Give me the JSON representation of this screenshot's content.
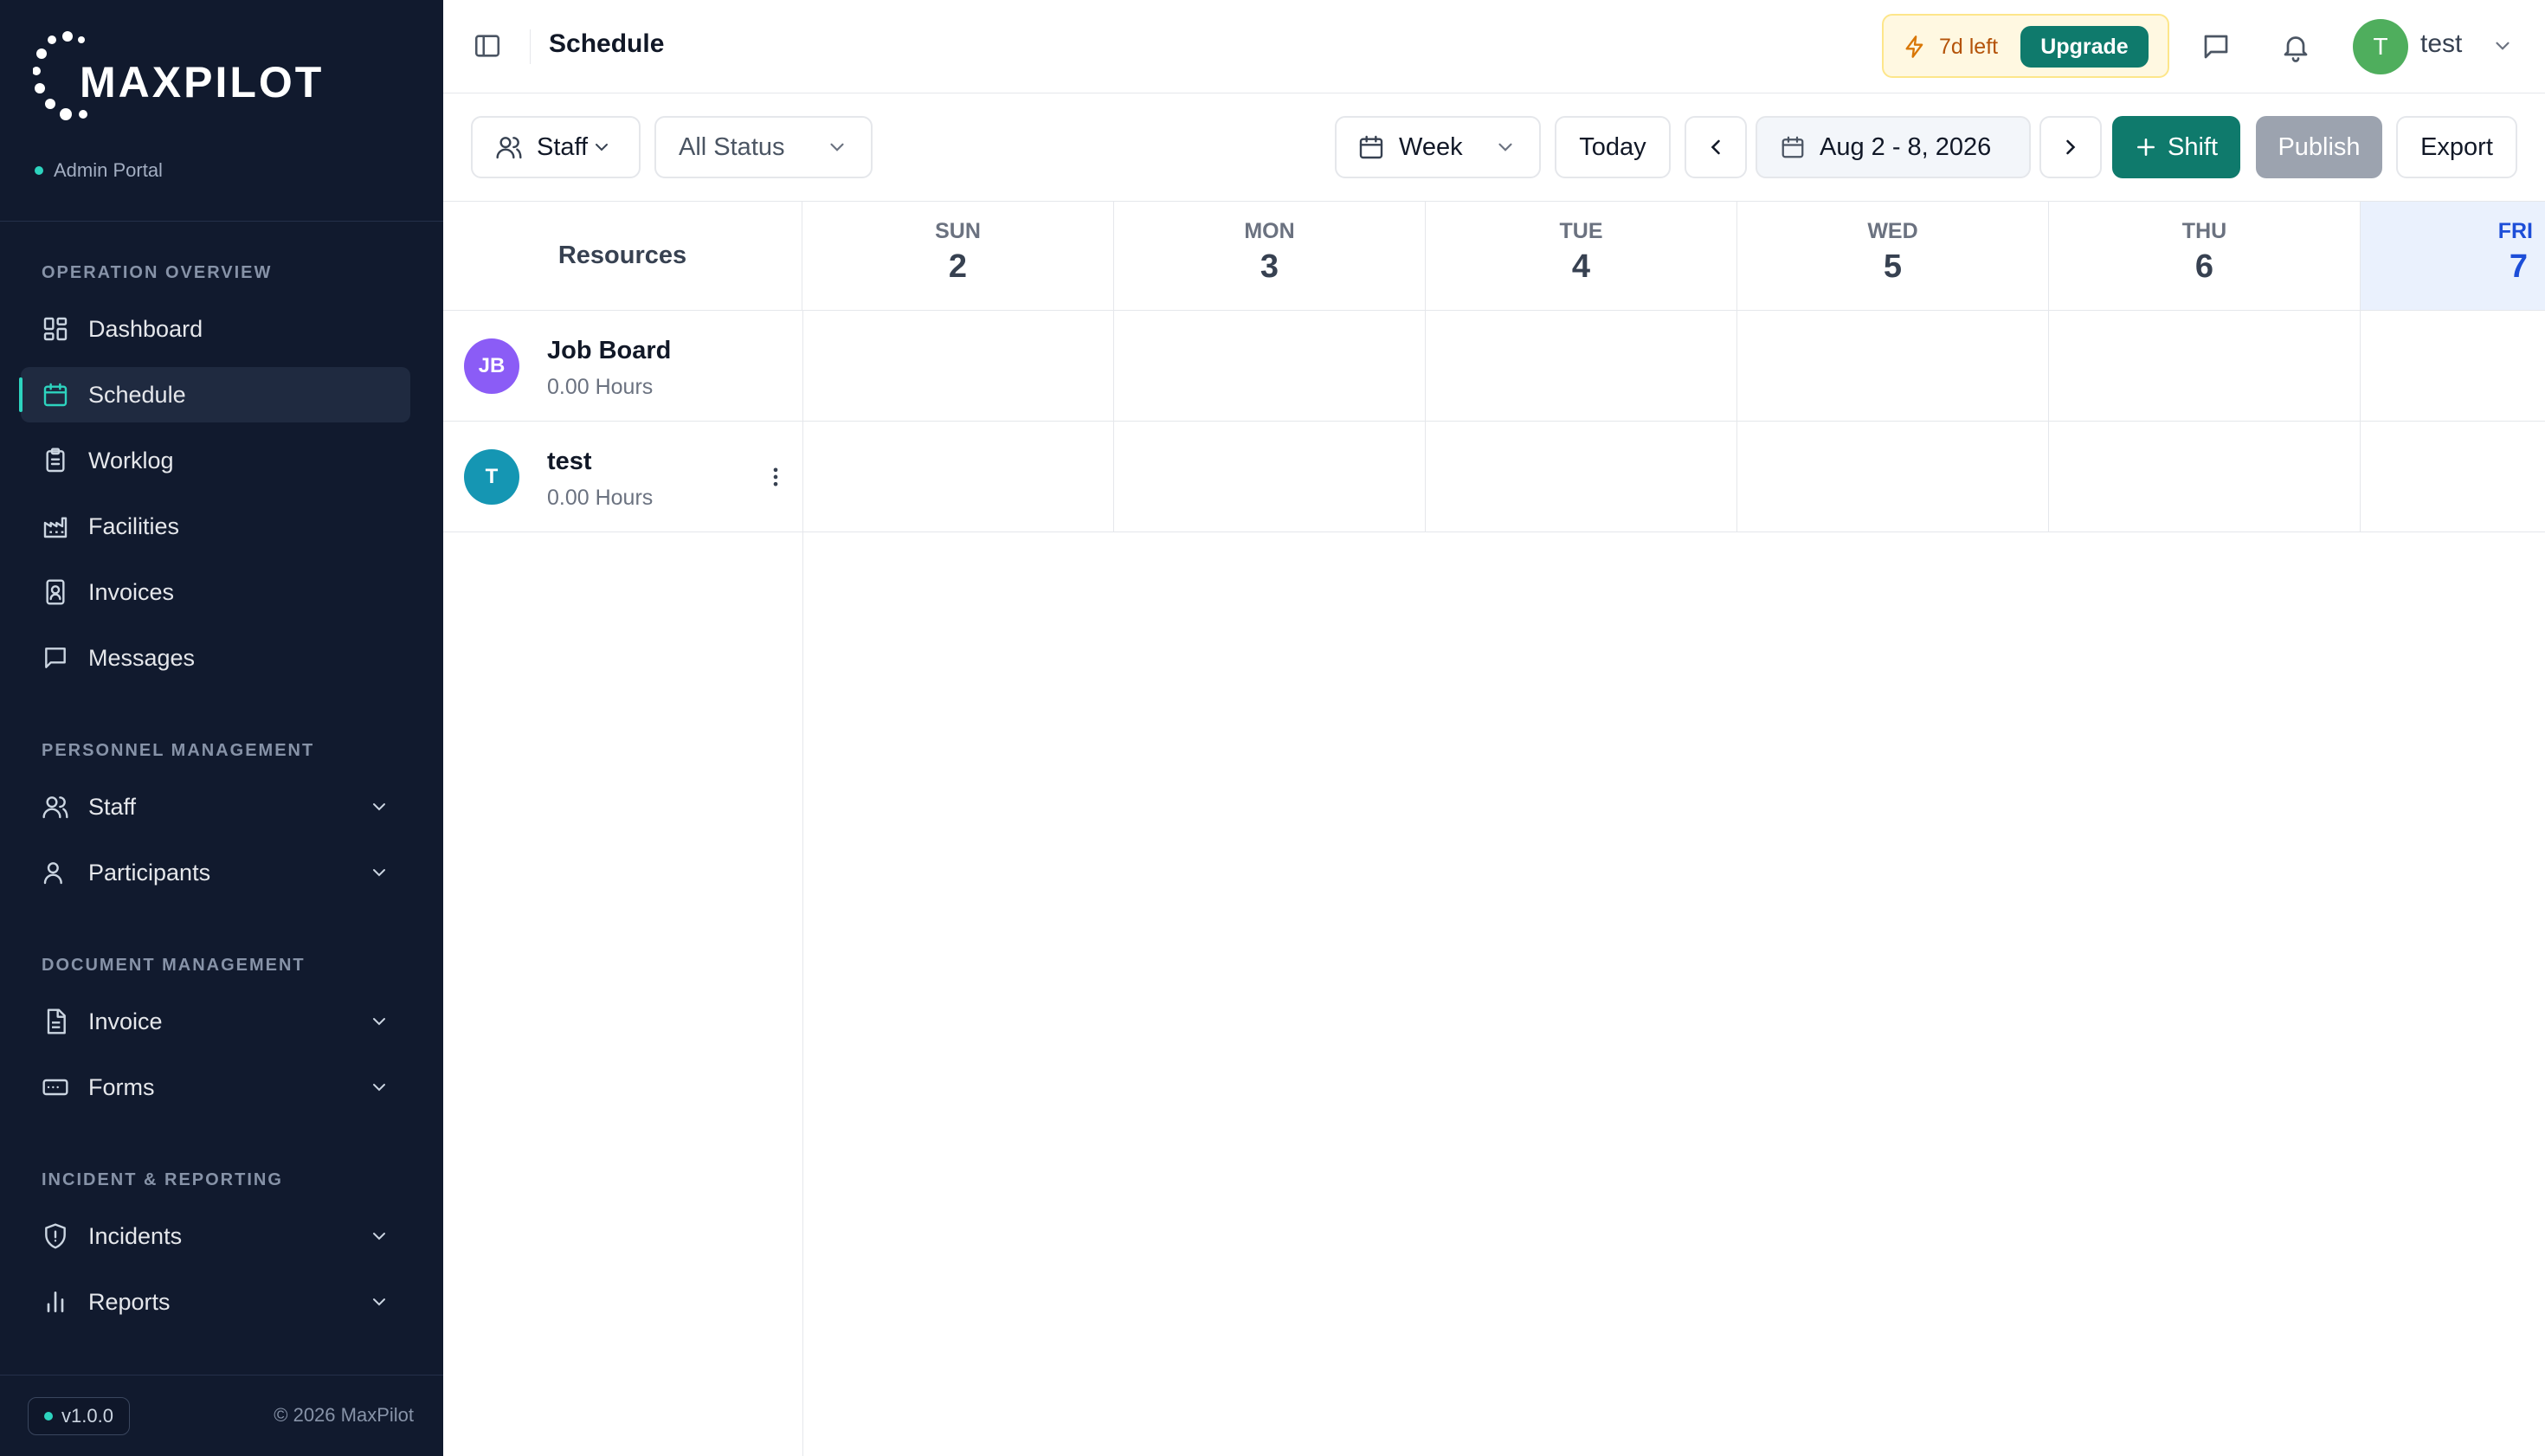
{
  "sidebar": {
    "brand": "MAXPILOT",
    "portal": "Admin Portal",
    "sections": {
      "operation": "OPERATION OVERVIEW",
      "personnel": "PERSONNEL MANAGEMENT",
      "document": "DOCUMENT MANAGEMENT",
      "incident": "INCIDENT & REPORTING"
    },
    "items": [
      {
        "label": "Dashboard"
      },
      {
        "label": "Schedule"
      },
      {
        "label": "Worklog"
      },
      {
        "label": "Facilities"
      },
      {
        "label": "Invoices"
      },
      {
        "label": "Messages"
      },
      {
        "label": "Staff"
      },
      {
        "label": "Participants"
      },
      {
        "label": "Invoice"
      },
      {
        "label": "Forms"
      },
      {
        "label": "Incidents"
      },
      {
        "label": "Reports"
      }
    ],
    "version": "v1.0.0",
    "copyright": "© 2026 MaxPilot"
  },
  "header": {
    "title": "Schedule",
    "trial_text": "7d left",
    "upgrade_label": "Upgrade",
    "user_initial": "T",
    "user_name": "test"
  },
  "toolbar": {
    "resource_filter": "Staff",
    "status_filter": "All Status",
    "view_mode": "Week",
    "today_label": "Today",
    "date_range": "Aug 2 - 8, 2026",
    "add_shift_label": "Shift",
    "publish_label": "Publish",
    "export_label": "Export"
  },
  "calendar": {
    "resources_header": "Resources",
    "days": [
      {
        "name": "SUN",
        "num": "2"
      },
      {
        "name": "MON",
        "num": "3"
      },
      {
        "name": "TUE",
        "num": "4"
      },
      {
        "name": "WED",
        "num": "5"
      },
      {
        "name": "THU",
        "num": "6"
      },
      {
        "name": "FRI",
        "num": "7"
      }
    ],
    "resources": [
      {
        "initials": "JB",
        "name": "Job Board",
        "hours": "0.00 Hours"
      },
      {
        "initials": "T",
        "name": "test",
        "hours": "0.00 Hours"
      }
    ]
  },
  "colors": {
    "sidebar_bg": "#111a2e",
    "accent": "#0f7a6c",
    "accent_highlight": "#2dd4bf",
    "today_bg": "#eaf1fd",
    "today_text": "#1d4ed8",
    "avatar_jobboard": "#8b5cf6",
    "avatar_test": "#1596b3",
    "avatar_user": "#4fae5d"
  }
}
